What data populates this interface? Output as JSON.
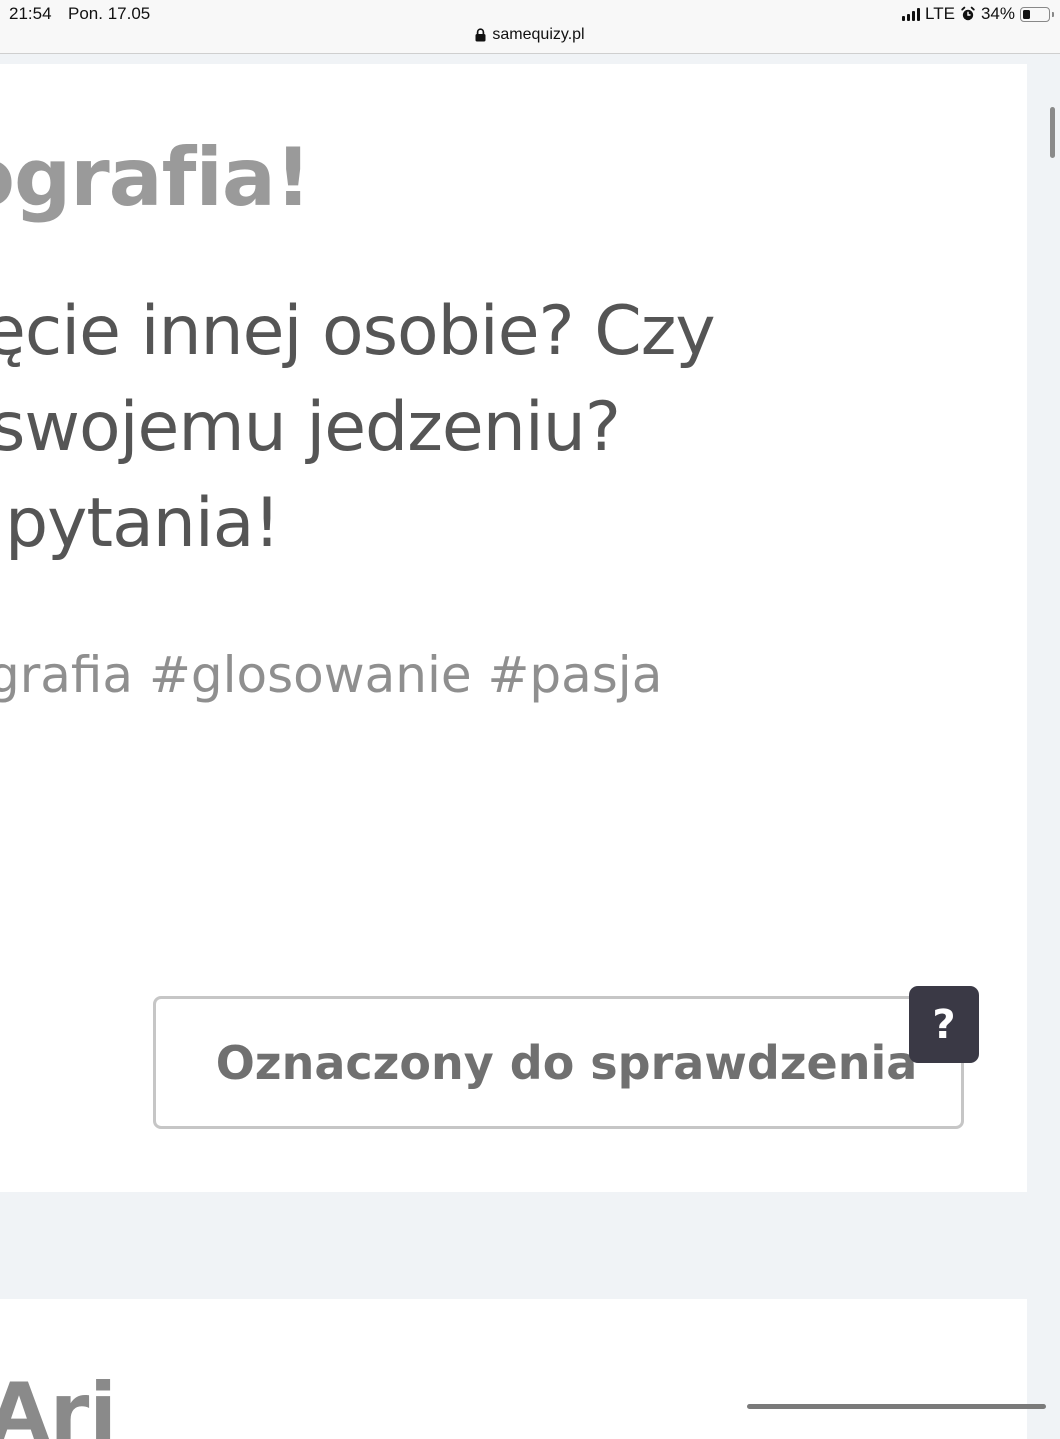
{
  "status_bar": {
    "time": "21:54",
    "date": "Pon. 17.05",
    "network": "LTE",
    "battery_percent": "34%",
    "battery_level": 0.34,
    "icons": [
      "signal-icon",
      "alarm-icon",
      "battery-icon"
    ]
  },
  "browser": {
    "url": "samequizy.pl",
    "icon": "lock-icon"
  },
  "quiz": {
    "title": "ografia!",
    "description_lines": [
      "ęcie innej osobie? Czy",
      " swojemu jedzeniu?",
      "pytania!"
    ],
    "tags": "grafia #glosowanie #pasja",
    "review_button_label": "Oznaczony do sprawdzenia",
    "help_button_label": "?"
  },
  "next_card": {
    "title": "Ari"
  },
  "colors": {
    "page_background": "#f0f3f6",
    "card_background": "#ffffff",
    "title_gray": "#9a9a9a",
    "text_dark": "#555555",
    "help_button_background": "#3a3945"
  }
}
